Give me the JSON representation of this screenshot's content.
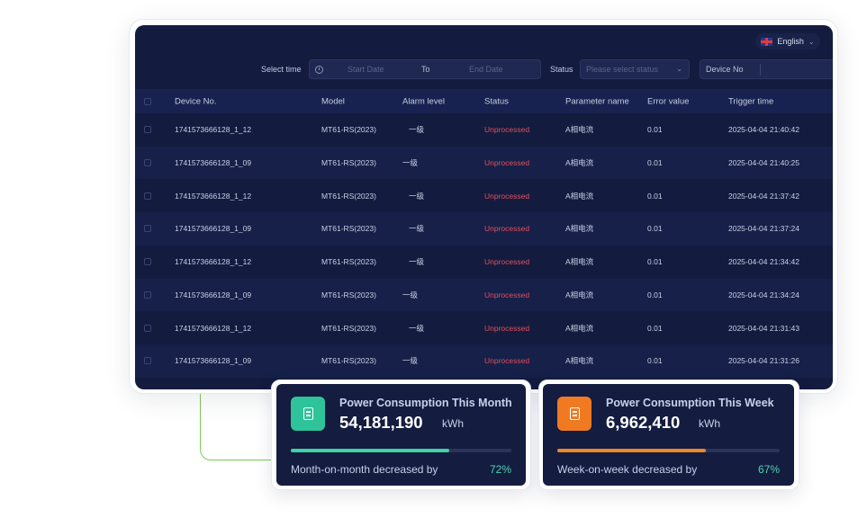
{
  "header": {
    "language": "English"
  },
  "filters": {
    "select_time_label": "Select time",
    "start_placeholder": "Start Date",
    "range_separator": "To",
    "end_placeholder": "End Date",
    "status_label": "Status",
    "status_placeholder": "Please select status",
    "device_value": "Device No"
  },
  "table": {
    "columns": [
      "Device No.",
      "Model",
      "Alarm level",
      "Status",
      "Parameter name",
      "Error value",
      "Trigger time"
    ],
    "rows": [
      {
        "device": "1741573666128_1_12",
        "model": "MT61-RS(2023)",
        "level": "一级",
        "status": "Unprocessed",
        "param": "A相电流",
        "error": "0.01",
        "time": "2025-04-04 21:40:42"
      },
      {
        "device": "1741573666128_1_09",
        "model": "MT61-RS(2023)",
        "level": "一级",
        "status": "Unprocessed",
        "param": "A相电流",
        "error": "0.01",
        "time": "2025-04-04 21:40:25"
      },
      {
        "device": "1741573666128_1_12",
        "model": "MT61-RS(2023)",
        "level": "一级",
        "status": "Unprocessed",
        "param": "A相电流",
        "error": "0.01",
        "time": "2025-04-04 21:37:42"
      },
      {
        "device": "1741573666128_1_09",
        "model": "MT61-RS(2023)",
        "level": "一级",
        "status": "Unprocessed",
        "param": "A相电流",
        "error": "0.01",
        "time": "2025-04-04 21:37:24"
      },
      {
        "device": "1741573666128_1_12",
        "model": "MT61-RS(2023)",
        "level": "一级",
        "status": "Unprocessed",
        "param": "A相电流",
        "error": "0.01",
        "time": "2025-04-04 21:34:42"
      },
      {
        "device": "1741573666128_1_09",
        "model": "MT61-RS(2023)",
        "level": "一级",
        "status": "Unprocessed",
        "param": "A相电流",
        "error": "0.01",
        "time": "2025-04-04 21:34:24"
      },
      {
        "device": "1741573666128_1_12",
        "model": "MT61-RS(2023)",
        "level": "一级",
        "status": "Unprocessed",
        "param": "A相电流",
        "error": "0.01",
        "time": "2025-04-04 21:31:43"
      },
      {
        "device": "1741573666128_1_09",
        "model": "MT61-RS(2023)",
        "level": "一级",
        "status": "Unprocessed",
        "param": "A相电流",
        "error": "0.01",
        "time": "2025-04-04 21:31:26"
      }
    ]
  },
  "cards": [
    {
      "icon": "document-icon",
      "icon_color": "#2fc39a",
      "title": "Power Consumption This Month",
      "value": "54,181,190",
      "unit": "kWh",
      "progress": 0.72,
      "bar_color": "#3ed3a4",
      "label": "Month-on-month decreased by",
      "percent": "72%",
      "percent_color": "#4fd3b0"
    },
    {
      "icon": "document-icon",
      "icon_color": "#f07a22",
      "title": "Power Consumption This Week",
      "value": "6,962,410",
      "unit": "kWh",
      "progress": 0.67,
      "bar_color": "#f0852a",
      "label": "Week-on-week decreased by",
      "percent": "67%",
      "percent_color": "#4fd3b0"
    }
  ],
  "colors": {
    "status_unprocessed": "#e0505a",
    "background_panel": "#131c3f"
  }
}
